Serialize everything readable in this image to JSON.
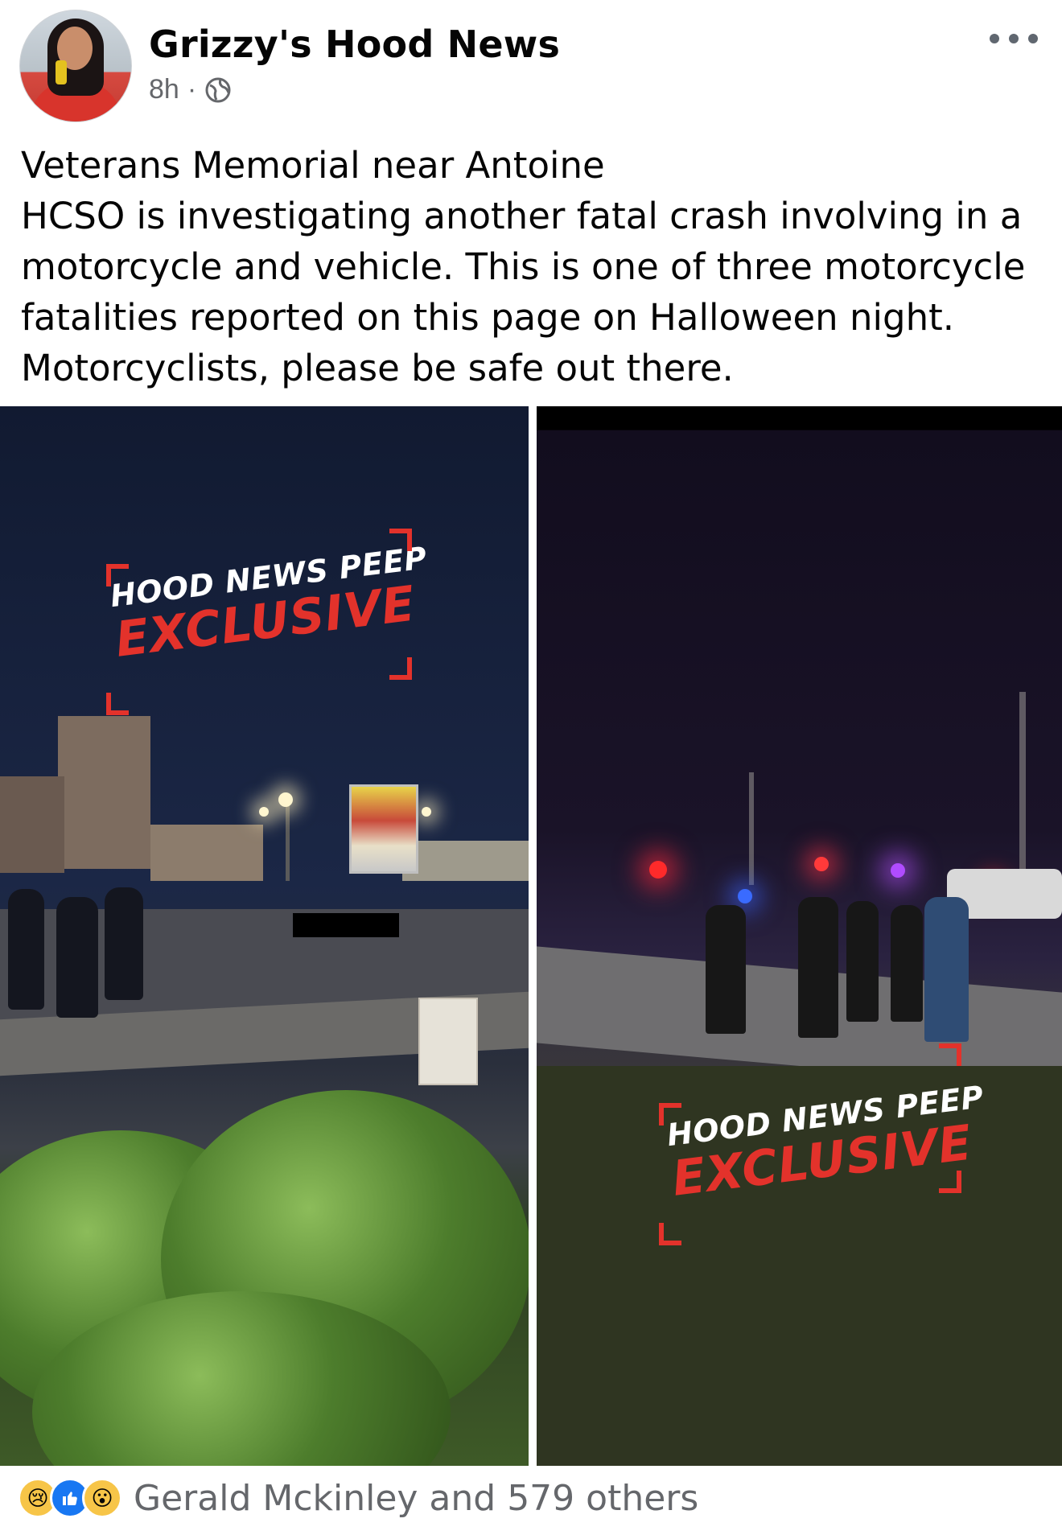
{
  "post": {
    "page_name": "Grizzy's Hood News",
    "time": "8h",
    "separator": "·",
    "privacy_icon": "globe-icon",
    "more_icon": "more-horizontal-icon",
    "text_lines": [
      "Veterans Memorial near Antoine",
      "HCSO is investigating another fatal crash involving in a",
      "motorcycle and vehicle. This is one of three motorcycle",
      "fatalities reported on this page on Halloween night.",
      "Motorcyclists, please be safe out there."
    ]
  },
  "media": {
    "photos": [
      {
        "watermark_line1": "HOOD NEWS PEEP",
        "watermark_line2": "EXCLUSIVE"
      },
      {
        "watermark_line1": "HOOD NEWS PEEP",
        "watermark_line2": "EXCLUSIVE"
      }
    ]
  },
  "reactions": {
    "icons": [
      "sad-reaction-icon",
      "like-reaction-icon",
      "wow-reaction-icon"
    ],
    "summary": "Gerald Mckinley and 579 others"
  },
  "colors": {
    "accent_red": "#e3322b",
    "like_blue": "#1877f2",
    "secondary_text": "#65676b"
  }
}
